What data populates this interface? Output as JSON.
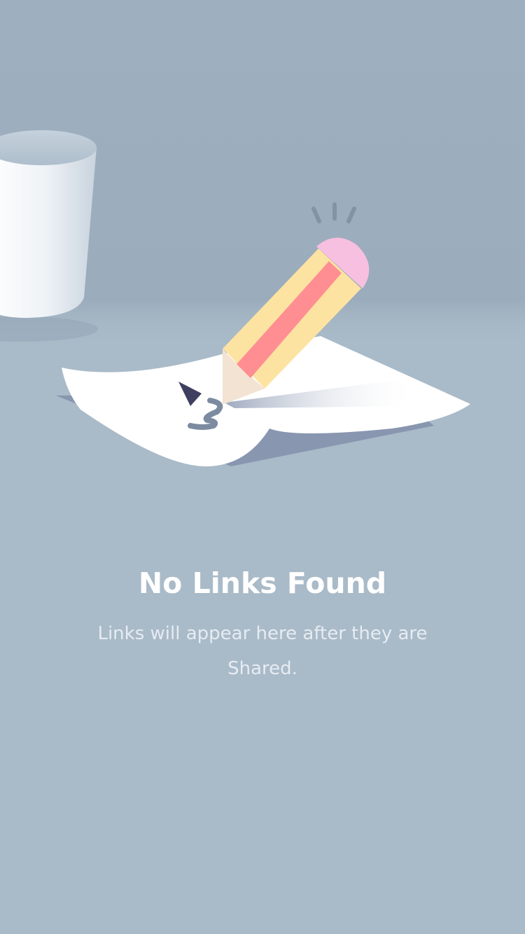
{
  "empty_state": {
    "title": "No Links Found",
    "message": "Links will appear here after they are Shared."
  },
  "illustration": {
    "depicts": "pencil-writing-on-paper-icon",
    "colors": {
      "background": "#a9bac8",
      "wall": "#9eb0c0",
      "pencil_body": "#fde3a1",
      "pencil_stripe": "#ff8e93",
      "eraser": "#f7bfe0",
      "paper": "#ffffff"
    }
  }
}
